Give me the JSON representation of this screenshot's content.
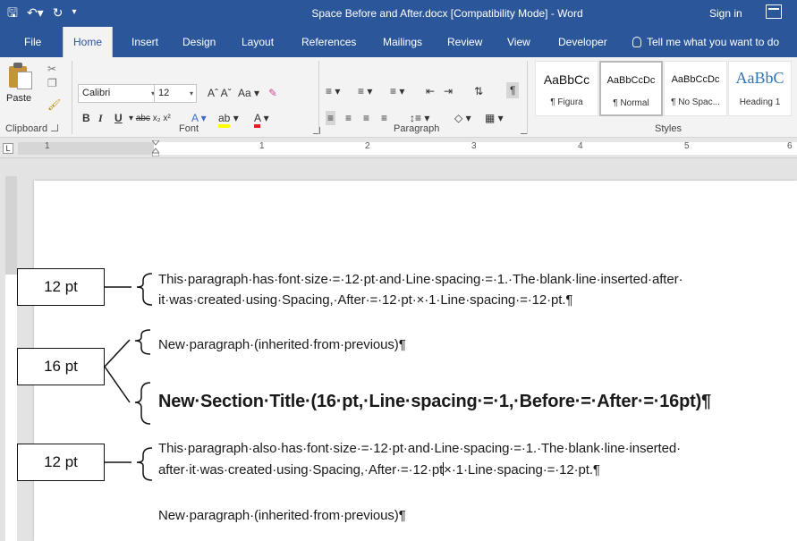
{
  "window": {
    "title": "Space Before and After.docx [Compatibility Mode] - Word",
    "sign_in": "Sign in"
  },
  "tabs": [
    {
      "label": "File"
    },
    {
      "label": "Home",
      "active": true
    },
    {
      "label": "Insert"
    },
    {
      "label": "Design"
    },
    {
      "label": "Layout"
    },
    {
      "label": "References"
    },
    {
      "label": "Mailings"
    },
    {
      "label": "Review"
    },
    {
      "label": "View"
    },
    {
      "label": "Developer"
    }
  ],
  "tell_me": "Tell me what you want to do",
  "ribbon": {
    "clipboard": {
      "label": "Clipboard",
      "paste_label": "Paste"
    },
    "font": {
      "label": "Font",
      "font_name": "Calibri",
      "font_size": "12"
    },
    "paragraph": {
      "label": "Paragraph"
    },
    "styles": {
      "label": "Styles",
      "items": [
        {
          "sample": "AaBbCc",
          "name": "¶ Figura"
        },
        {
          "sample": "AaBbCcDc",
          "name": "¶ Normal",
          "selected": true
        },
        {
          "sample": "AaBbCcDc",
          "name": "¶ No Spac..."
        },
        {
          "sample": "AaBbC",
          "name": "Heading 1"
        }
      ]
    }
  },
  "ruler": {
    "numbers": [
      "1",
      "1",
      "2",
      "3",
      "4",
      "5",
      "6"
    ]
  },
  "document": {
    "p1_line1": "This·paragraph·has·font·size·=·12·pt·and·Line·spacing·=·1.·The·blank·line·inserted·after·",
    "p1_line2": "it·was·created·using·Spacing,·After·=·12·pt·×·1·Line·spacing·=·12·pt.¶",
    "p2": "New·paragraph·(inherited·from·previous)¶",
    "title": "New·Section·Title·(16·pt,·Line·spacing·=·1,·Before·=·After·=·16pt)¶",
    "p3_line1": "This·paragraph·also·has·font·size·=·12·pt·and·Line·spacing·=·1.·The·blank·line·inserted·",
    "p3_line2_a": "after·it·was·created·using·Spacing,·After·=·12·pt",
    "p3_line2_b": "×·1·Line·spacing·=·12·pt.¶",
    "p4": "New·paragraph·(inherited·from·previous)¶"
  },
  "callouts": [
    {
      "label": "12 pt"
    },
    {
      "label": "16 pt"
    },
    {
      "label": "12 pt"
    }
  ],
  "colors": {
    "accent": "#2b579a",
    "heading_blue": "#2e74b5"
  }
}
